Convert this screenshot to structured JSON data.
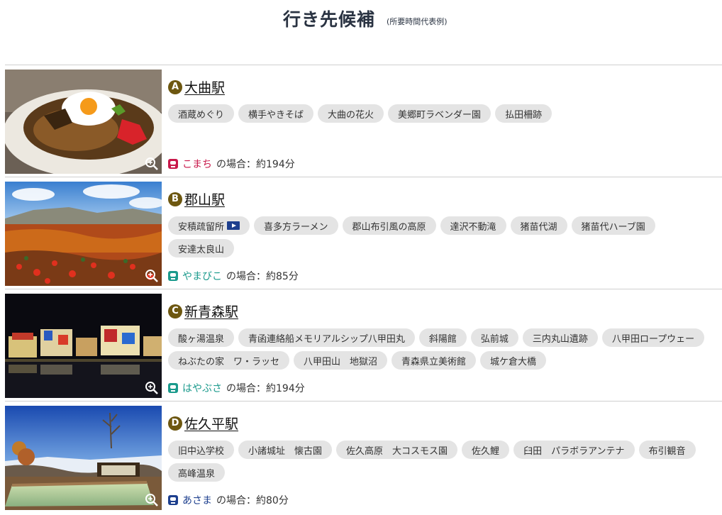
{
  "header": {
    "title": "行き先候補",
    "subtitle": "(所要時間代表例)"
  },
  "destinations": [
    {
      "letter": "A",
      "station": "大曲駅",
      "tags": [
        "酒蔵めぐり",
        "横手やきそば",
        "大曲の花火",
        "美郷町ラベンダー園",
        "払田柵跡"
      ],
      "train": "こまち",
      "train_color": "#c8184a",
      "time_text": "の場合：約194分",
      "photo_icon": "zoom-icon"
    },
    {
      "letter": "B",
      "station": "郡山駅",
      "tags": [
        "安積疏留所",
        "喜多方ラーメン",
        "郡山布引風の高原",
        "達沢不動滝",
        "猪苗代湖",
        "猪苗代ハーブ園",
        "安達太良山"
      ],
      "video_tag_index": 0,
      "train": "やまびこ",
      "train_color": "#1a9a8c",
      "time_text": "の場合：約85分",
      "photo_icon": "zoom-icon"
    },
    {
      "letter": "C",
      "station": "新青森駅",
      "tags": [
        "酸ヶ湯温泉",
        "青函連絡船メモリアルシップ八甲田丸",
        "斜陽館",
        "弘前城",
        "三内丸山遺跡",
        "八甲田ロープウェー",
        "ねぶたの家　ワ・ラッセ",
        "八甲田山　地獄沼",
        "青森県立美術館",
        "城ケ倉大橋"
      ],
      "train": "はやぶさ",
      "train_color": "#1a9a8c",
      "time_text": "の場合：約194分",
      "photo_icon": "zoom-icon"
    },
    {
      "letter": "D",
      "station": "佐久平駅",
      "tags": [
        "旧中込学校",
        "小諸城址　懐古園",
        "佐久高原　大コスモス園",
        "佐久鯉",
        "臼田　パラボラアンテナ",
        "布引観音",
        "高峰温泉"
      ],
      "train": "あさま",
      "train_color": "#1d3f8e",
      "time_text": "の場合：約80分",
      "photo_icon": "zoom-icon"
    }
  ],
  "colors": {
    "letter_badge": "#6d5710",
    "tag_bg": "#e4e4e4",
    "title": "#2a3342"
  }
}
